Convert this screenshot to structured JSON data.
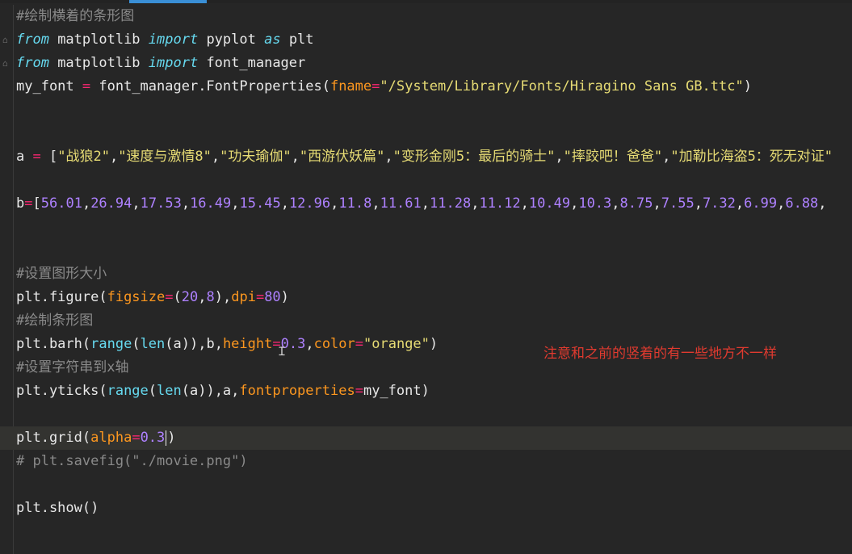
{
  "editor": {
    "lines": [
      {
        "segs": [
          {
            "c": "cmt",
            "t": "#绘制横着的条形图"
          }
        ]
      },
      {
        "fold": true,
        "segs": [
          {
            "c": "kw",
            "t": "from"
          },
          {
            "c": "plain",
            "t": " matplotlib "
          },
          {
            "c": "kw",
            "t": "import"
          },
          {
            "c": "plain",
            "t": " pyplot "
          },
          {
            "c": "kw",
            "t": "as"
          },
          {
            "c": "plain",
            "t": " plt"
          }
        ]
      },
      {
        "fold": true,
        "segs": [
          {
            "c": "kw",
            "t": "from"
          },
          {
            "c": "plain",
            "t": " matplotlib "
          },
          {
            "c": "kw",
            "t": "import"
          },
          {
            "c": "plain",
            "t": " font_manager"
          }
        ]
      },
      {
        "segs": [
          {
            "c": "plain",
            "t": "my_font "
          },
          {
            "c": "op",
            "t": "="
          },
          {
            "c": "plain",
            "t": " font_manager.FontProperties("
          },
          {
            "c": "arg",
            "t": "fname"
          },
          {
            "c": "op",
            "t": "="
          },
          {
            "c": "str",
            "t": "\"/System/Library/Fonts/Hiragino Sans GB.ttc\""
          },
          {
            "c": "plain",
            "t": ")"
          }
        ]
      },
      {
        "segs": []
      },
      {
        "segs": []
      },
      {
        "segs": [
          {
            "c": "plain",
            "t": "a "
          },
          {
            "c": "op",
            "t": "="
          },
          {
            "c": "plain",
            "t": " ["
          },
          {
            "c": "str",
            "t": "\"战狼2\""
          },
          {
            "c": "plain",
            "t": ","
          },
          {
            "c": "str",
            "t": "\"速度与激情8\""
          },
          {
            "c": "plain",
            "t": ","
          },
          {
            "c": "str",
            "t": "\"功夫瑜伽\""
          },
          {
            "c": "plain",
            "t": ","
          },
          {
            "c": "str",
            "t": "\"西游伏妖篇\""
          },
          {
            "c": "plain",
            "t": ","
          },
          {
            "c": "str",
            "t": "\"变形金刚5：最后的骑士\""
          },
          {
            "c": "plain",
            "t": ","
          },
          {
            "c": "str",
            "t": "\"摔跤吧！爸爸\""
          },
          {
            "c": "plain",
            "t": ","
          },
          {
            "c": "str",
            "t": "\"加勒比海盗5：死无对证\""
          }
        ]
      },
      {
        "segs": []
      },
      {
        "segs": [
          {
            "c": "plain",
            "t": "b"
          },
          {
            "c": "op",
            "t": "="
          },
          {
            "c": "plain",
            "t": "["
          },
          {
            "c": "num",
            "t": "56.01"
          },
          {
            "c": "plain",
            "t": ","
          },
          {
            "c": "num",
            "t": "26.94"
          },
          {
            "c": "plain",
            "t": ","
          },
          {
            "c": "num",
            "t": "17.53"
          },
          {
            "c": "plain",
            "t": ","
          },
          {
            "c": "num",
            "t": "16.49"
          },
          {
            "c": "plain",
            "t": ","
          },
          {
            "c": "num",
            "t": "15.45"
          },
          {
            "c": "plain",
            "t": ","
          },
          {
            "c": "num",
            "t": "12.96"
          },
          {
            "c": "plain",
            "t": ","
          },
          {
            "c": "num",
            "t": "11.8"
          },
          {
            "c": "plain",
            "t": ","
          },
          {
            "c": "num",
            "t": "11.61"
          },
          {
            "c": "plain",
            "t": ","
          },
          {
            "c": "num",
            "t": "11.28"
          },
          {
            "c": "plain",
            "t": ","
          },
          {
            "c": "num",
            "t": "11.12"
          },
          {
            "c": "plain",
            "t": ","
          },
          {
            "c": "num",
            "t": "10.49"
          },
          {
            "c": "plain",
            "t": ","
          },
          {
            "c": "num",
            "t": "10.3"
          },
          {
            "c": "plain",
            "t": ","
          },
          {
            "c": "num",
            "t": "8.75"
          },
          {
            "c": "plain",
            "t": ","
          },
          {
            "c": "num",
            "t": "7.55"
          },
          {
            "c": "plain",
            "t": ","
          },
          {
            "c": "num",
            "t": "7.32"
          },
          {
            "c": "plain",
            "t": ","
          },
          {
            "c": "num",
            "t": "6.99"
          },
          {
            "c": "plain",
            "t": ","
          },
          {
            "c": "num",
            "t": "6.88"
          },
          {
            "c": "plain",
            "t": ","
          }
        ]
      },
      {
        "segs": []
      },
      {
        "segs": []
      },
      {
        "segs": [
          {
            "c": "cmt",
            "t": "#设置图形大小"
          }
        ]
      },
      {
        "segs": [
          {
            "c": "plain",
            "t": "plt.figure("
          },
          {
            "c": "arg",
            "t": "figsize"
          },
          {
            "c": "op",
            "t": "="
          },
          {
            "c": "plain",
            "t": "("
          },
          {
            "c": "num",
            "t": "20"
          },
          {
            "c": "plain",
            "t": ","
          },
          {
            "c": "num",
            "t": "8"
          },
          {
            "c": "plain",
            "t": "),"
          },
          {
            "c": "arg",
            "t": "dpi"
          },
          {
            "c": "op",
            "t": "="
          },
          {
            "c": "num",
            "t": "80"
          },
          {
            "c": "plain",
            "t": ")"
          }
        ]
      },
      {
        "segs": [
          {
            "c": "cmt",
            "t": "#绘制条形图"
          }
        ]
      },
      {
        "segs": [
          {
            "c": "plain",
            "t": "plt.barh("
          },
          {
            "c": "fn",
            "t": "range"
          },
          {
            "c": "plain",
            "t": "("
          },
          {
            "c": "fn",
            "t": "len"
          },
          {
            "c": "plain",
            "t": "(a)),b,"
          },
          {
            "c": "arg",
            "t": "height"
          },
          {
            "c": "op",
            "t": "="
          },
          {
            "c": "num",
            "t": "0.3"
          },
          {
            "c": "plain",
            "t": ","
          },
          {
            "c": "arg",
            "t": "color"
          },
          {
            "c": "op",
            "t": "="
          },
          {
            "c": "str",
            "t": "\"orange\""
          },
          {
            "c": "plain",
            "t": ")"
          }
        ]
      },
      {
        "segs": [
          {
            "c": "cmt",
            "t": "#设置字符串到x轴"
          }
        ]
      },
      {
        "segs": [
          {
            "c": "plain",
            "t": "plt.yticks("
          },
          {
            "c": "fn",
            "t": "range"
          },
          {
            "c": "plain",
            "t": "("
          },
          {
            "c": "fn",
            "t": "len"
          },
          {
            "c": "plain",
            "t": "(a)),a,"
          },
          {
            "c": "arg",
            "t": "fontproperties"
          },
          {
            "c": "op",
            "t": "="
          },
          {
            "c": "plain",
            "t": "my_font)"
          }
        ]
      },
      {
        "segs": []
      },
      {
        "highlight": true,
        "segs": [
          {
            "c": "plain",
            "t": "plt.grid("
          },
          {
            "c": "arg",
            "t": "alpha"
          },
          {
            "c": "op",
            "t": "="
          },
          {
            "c": "num",
            "t": "0.3"
          },
          {
            "c": "cursor",
            "t": ""
          },
          {
            "c": "plain",
            "t": ")"
          }
        ]
      },
      {
        "segs": [
          {
            "c": "cmt",
            "t": "# plt.savefig(\"./movie.png\")"
          }
        ]
      },
      {
        "segs": []
      },
      {
        "segs": [
          {
            "c": "plain",
            "t": "plt.show()"
          }
        ]
      }
    ]
  },
  "annotation": {
    "text": "注意和之前的竖着的有一些地方不一样"
  }
}
